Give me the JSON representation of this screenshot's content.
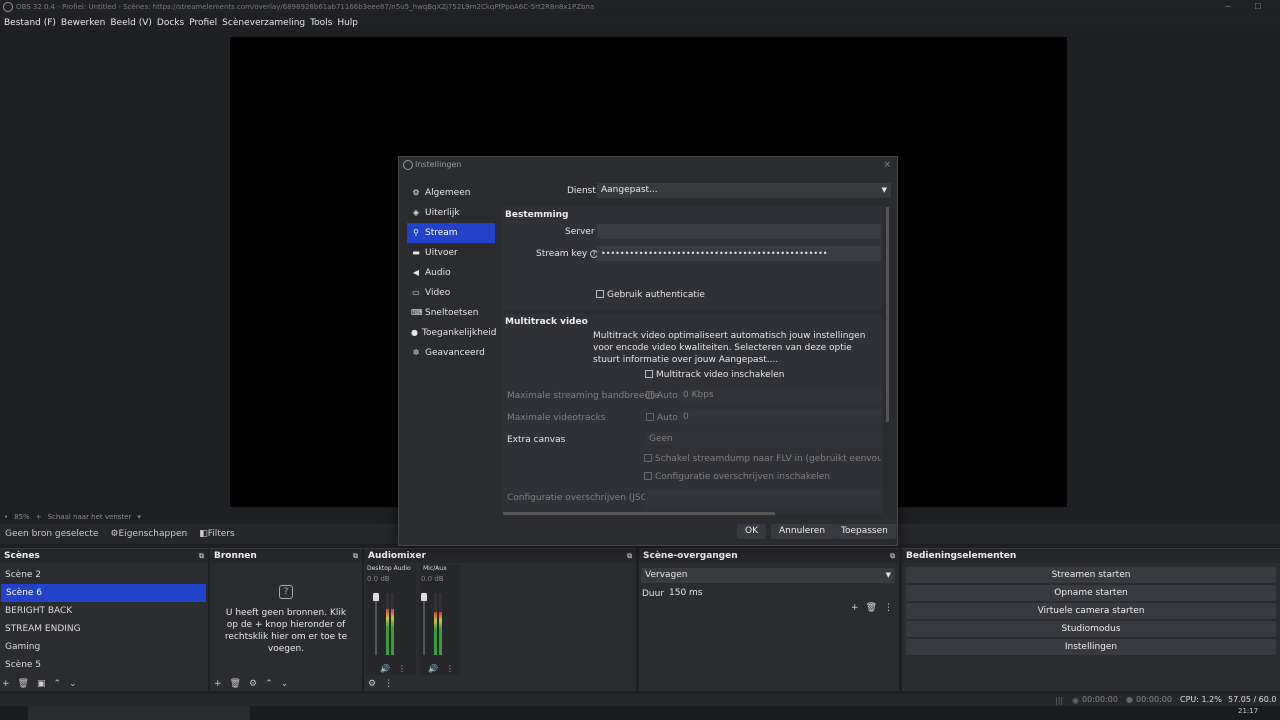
{
  "window": {
    "title": "OBS 32.0.4 - Profiel: Untitled - Scènes: https://streamelements.com/overlay/6898928b61ab71166b3eee87/n5u5_hwqBqXZj752L9m2CkqPfPpoA6C-5rt2R8n8x1PZbna",
    "minimize": "─",
    "maximize": "☐"
  },
  "menu": [
    "Bestand (F)",
    "Bewerken",
    "Beeld (V)",
    "Docks",
    "Profiel",
    "Scèneverzameling",
    "Tools",
    "Hulp"
  ],
  "preview_status": {
    "zoom_marker": "•",
    "zoom": "85%",
    "plus": "+",
    "scale_mode": "Schaal naar het venster",
    "caret": "▾"
  },
  "source_toolbar": {
    "no_source": "Geen bron geselecte",
    "properties": "Eigenschappen",
    "filters": "Filters",
    "properties_icon": "⚙",
    "filters_icon": "◧"
  },
  "dialog": {
    "title": "Instellingen",
    "close": "×",
    "nav": [
      {
        "label": "Algemeen",
        "icon": "⚙"
      },
      {
        "label": "Uiterlijk",
        "icon": "◈"
      },
      {
        "label": "Stream",
        "icon": "⚲"
      },
      {
        "label": "Uitvoer",
        "icon": "▬"
      },
      {
        "label": "Audio",
        "icon": "◀"
      },
      {
        "label": "Video",
        "icon": "▭"
      },
      {
        "label": "Sneltoetsen",
        "icon": "⌨"
      },
      {
        "label": "Toegankelijkheid",
        "icon": "●"
      },
      {
        "label": "Geavanceerd",
        "icon": "✲"
      }
    ],
    "service_label": "Dienst",
    "service_value": "Aangepast...",
    "destination_title": "Bestemming",
    "server_label": "Server",
    "server_value": "",
    "streamkey_label": "Stream key",
    "streamkey_help": "?",
    "streamkey_value": "••••••••••••••••••••••••••••••••••••••••••••••••",
    "use_auth": "Gebruik authenticatie",
    "multitrack_title": "Multitrack video",
    "multitrack_desc": "Multitrack video optimaliseert automatisch jouw instellingen voor encode video kwaliteiten. Selecteren van deze optie stuurt informatie over jouw Aangepast....",
    "multitrack_enable": "Multitrack video inschakelen",
    "max_bw_label": "Maximale streaming bandbreedte",
    "auto1": "Auto",
    "max_bw_value": "0 Kbps",
    "max_tracks_label": "Maximale videotracks",
    "auto2": "Auto",
    "max_tracks_value": "0",
    "extra_canvas_label": "Extra canvas",
    "extra_canvas_value": "Geen",
    "dump_flv": "Schakel streamdump naar FLV in (gebruikt eenvoudige in",
    "override_cfg": "Configuratie overschrijven inschakelen",
    "override_json_label": "Configuratie overschrijven (JSON)",
    "ok": "OK",
    "cancel": "Annuleren",
    "apply": "Toepassen"
  },
  "scenes": {
    "title": "Scènes",
    "items": [
      "Scène 2",
      "Scène 6",
      "BERIGHT BACK",
      "STREAM ENDING",
      "Gaming",
      "Scène 5"
    ],
    "selected": 1,
    "tools": [
      "+",
      "🗑",
      "▣",
      "⌃",
      "⌄"
    ]
  },
  "sources": {
    "title": "Bronnen",
    "empty_icon": "?",
    "empty_text": "U heeft geen bronnen. Klik op de + knop hieronder of rechtsklik hier om er toe te voegen.",
    "tools": [
      "+",
      "🗑",
      "⚙",
      "⌃",
      "⌄"
    ]
  },
  "audiomixer": {
    "title": "Audiomixer",
    "channels": [
      {
        "name": "Desktop Audio",
        "db": "0.0 dB",
        "level": 0.75
      },
      {
        "name": "Mic/Aux",
        "db": "0.0 dB",
        "level": 0.7
      }
    ],
    "tools": [
      "⚙",
      "⋮"
    ],
    "channel_icons": [
      "🔊",
      "⋮"
    ]
  },
  "transitions": {
    "title": "Scène-overgangen",
    "type": "Vervagen",
    "duration_label": "Duur",
    "duration": "150 ms",
    "tools": [
      "+",
      "🗑",
      "⋮"
    ]
  },
  "controls": {
    "title": "Bedieningselementen",
    "buttons": [
      "Streamen starten",
      "Opname starten",
      "Virtuele camera starten",
      "Studiomodus",
      "Instellingen"
    ]
  },
  "statusbar": {
    "stream_time": "00:00:00",
    "rec_time": "00:00:00",
    "cpu": "CPU: 1.2%",
    "fps": "57.05 / 60.0"
  },
  "taskbar": {
    "clock": "21:17"
  }
}
